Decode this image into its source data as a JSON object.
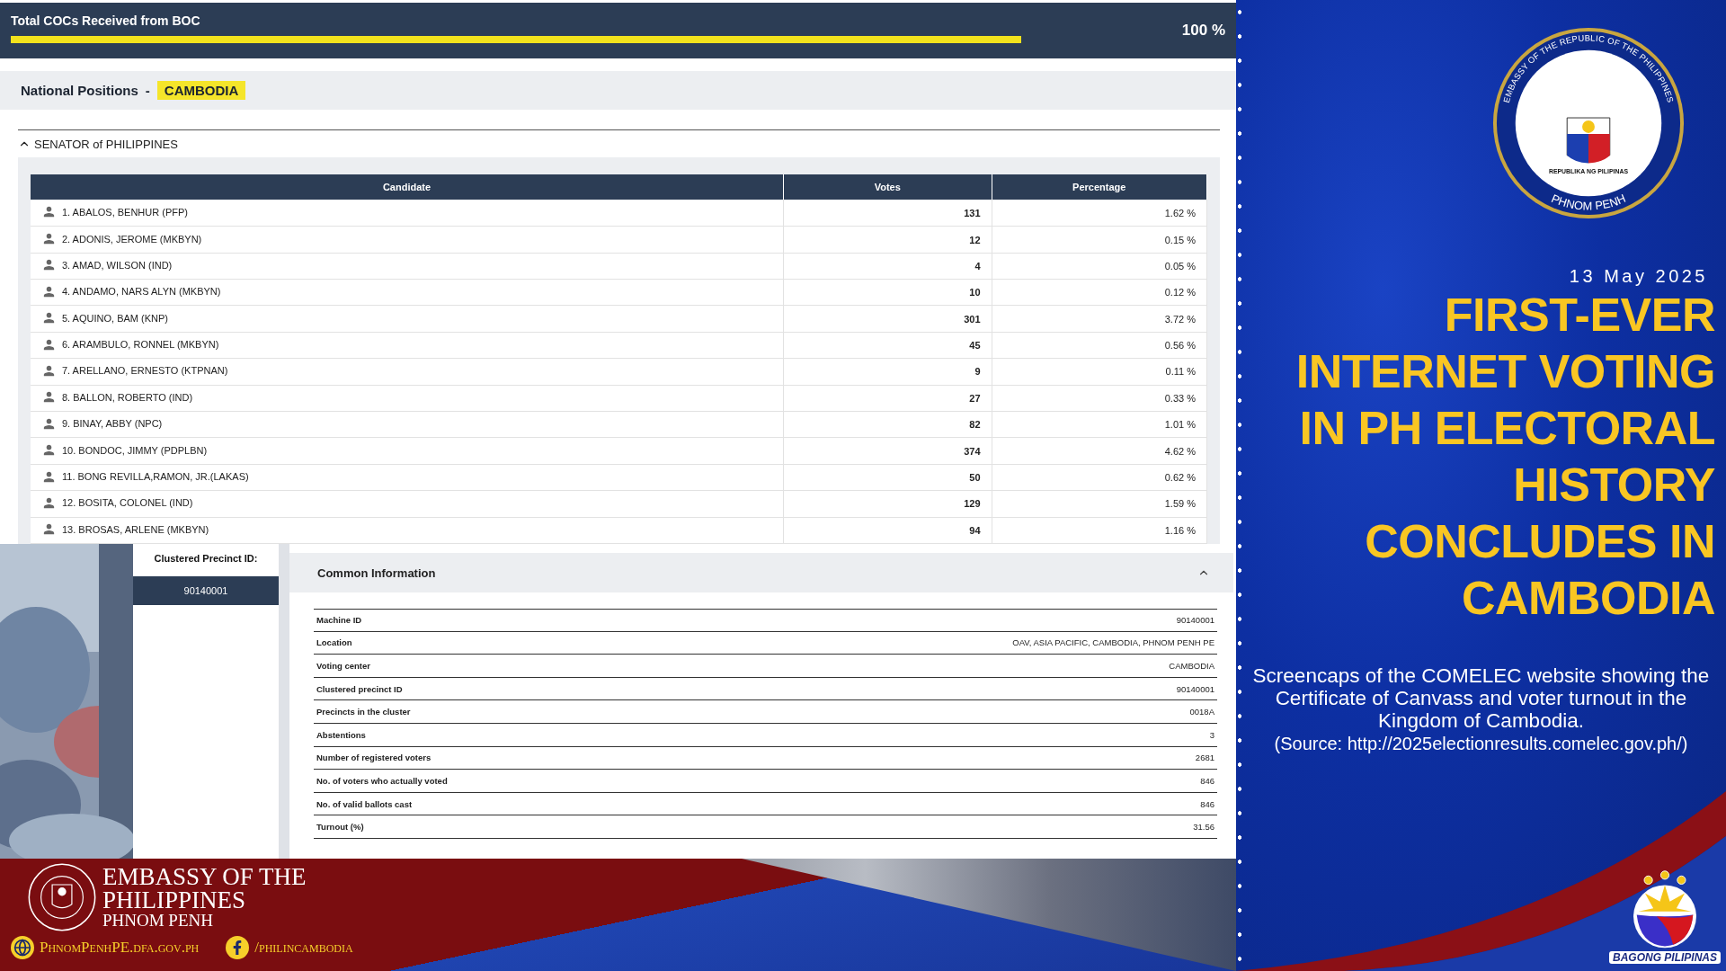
{
  "progress": {
    "label": "Total COCs Received from BOC",
    "level": 1,
    "reading": "100 %"
  },
  "positions_header": {
    "label": "National Positions",
    "separator": "-",
    "tag": "CAMBODIA"
  },
  "contest": {
    "title": "SENATOR of PHILIPPINES",
    "expanded": true
  },
  "results_table": {
    "columns": [
      "Candidate",
      "Votes",
      "Percentage"
    ],
    "rows": [
      {
        "candidate": "1. ABALOS, BENHUR (PFP)",
        "votes": "131",
        "percentage": "1.62 %"
      },
      {
        "candidate": "2. ADONIS, JEROME (MKBYN)",
        "votes": "12",
        "percentage": "0.15 %"
      },
      {
        "candidate": "3. AMAD, WILSON (IND)",
        "votes": "4",
        "percentage": "0.05 %"
      },
      {
        "candidate": "4. ANDAMO, NARS ALYN (MKBYN)",
        "votes": "10",
        "percentage": "0.12 %"
      },
      {
        "candidate": "5. AQUINO, BAM (KNP)",
        "votes": "301",
        "percentage": "3.72 %"
      },
      {
        "candidate": "6. ARAMBULO, RONNEL (MKBYN)",
        "votes": "45",
        "percentage": "0.56 %"
      },
      {
        "candidate": "7. ARELLANO, ERNESTO (KTPNAN)",
        "votes": "9",
        "percentage": "0.11 %"
      },
      {
        "candidate": "8. BALLON, ROBERTO (IND)",
        "votes": "27",
        "percentage": "0.33 %"
      },
      {
        "candidate": "9. BINAY, ABBY (NPC)",
        "votes": "82",
        "percentage": "1.01 %"
      },
      {
        "candidate": "10. BONDOC, JIMMY (PDPLBN)",
        "votes": "374",
        "percentage": "4.62 %"
      },
      {
        "candidate": "11. BONG REVILLA,RAMON, JR.(LAKAS)",
        "votes": "50",
        "percentage": "0.62 %"
      },
      {
        "candidate": "12. BOSITA, COLONEL (IND)",
        "votes": "129",
        "percentage": "1.59 %"
      },
      {
        "candidate": "13. BROSAS, ARLENE (MKBYN)",
        "votes": "94",
        "percentage": "1.16 %"
      }
    ]
  },
  "precinct_sidebar": {
    "label": "Clustered Precinct ID:",
    "items": [
      {
        "label": "90140001",
        "selected": true
      }
    ]
  },
  "common_information": {
    "title": "Common Information",
    "expanded": true,
    "rows": [
      {
        "label": "Machine ID",
        "value": "90140001"
      },
      {
        "label": "Location",
        "value": "OAV, ASIA PACIFIC, CAMBODIA, PHNOM PENH PE"
      },
      {
        "label": "Voting center",
        "value": "CAMBODIA"
      },
      {
        "label": "Clustered precinct ID",
        "value": "90140001"
      },
      {
        "label": "Precincts in the cluster",
        "value": "0018A"
      },
      {
        "label": "Abstentions",
        "value": "3"
      },
      {
        "label": "Number of registered voters",
        "value": "2681"
      },
      {
        "label": "No. of voters who actually voted",
        "value": "846"
      },
      {
        "label": "No. of valid ballots cast",
        "value": "846"
      },
      {
        "label": "Turnout (%)",
        "value": "31.56"
      }
    ]
  },
  "poster": {
    "seal": {
      "top_text": "EMBASSY OF THE REPUBLIC OF THE PHILIPPINES",
      "ribbon_text": "REPUBLIKA NG PILIPINAS",
      "bottom_text": "PHNOM PENH"
    },
    "date": "13 May 2025",
    "headline": [
      "FIRST-EVER",
      "INTERNET VOTING",
      "IN PH ELECTORAL",
      "HISTORY",
      "CONCLUDES IN",
      "CAMBODIA"
    ],
    "caption": "Screencaps of the COMELEC website showing the Certificate of Canvass and voter turnout in the Kingdom of Cambodia.",
    "source": "(Source: http://2025electionresults.comelec.gov.ph/)",
    "badge_text": "BAGONG PILIPINAS"
  },
  "footer": {
    "org_name": [
      "EMBASSY OF THE",
      "PHILIPPINES",
      "PHNOM PENH"
    ],
    "links": [
      {
        "kind": "website",
        "label": "PhnomPenhPE.dfa.gov.ph"
      },
      {
        "kind": "facebook",
        "label": "/philincambodia"
      }
    ]
  }
}
